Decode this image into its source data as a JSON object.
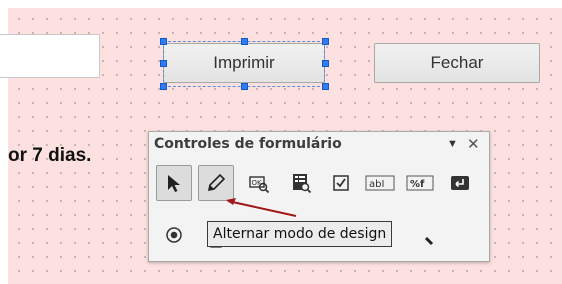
{
  "form": {
    "print_button": "Imprimir",
    "close_button": "Fechar",
    "label_text": "or 7 dias."
  },
  "toolbar": {
    "title": "Controles de formulário",
    "dropdown_icon": "triangle-down-icon",
    "close_icon": "close-icon",
    "row1": [
      "select-arrow-icon",
      "design-mode-pencil-icon",
      "control-properties-icon",
      "form-properties-icon",
      "checkbox-icon",
      "text-box-icon",
      "formatted-field-icon",
      "push-button-icon"
    ],
    "row2": [
      "option-button-icon",
      "list-box-icon"
    ],
    "textbox_glyph": "abI",
    "formatted_glyph": "%f"
  },
  "tooltip": {
    "text": "Alternar modo de design"
  },
  "colors": {
    "canvas_background": "#fde1e1",
    "selection_handle": "#2f7cf6",
    "annotation_arrow": "#a01818"
  }
}
